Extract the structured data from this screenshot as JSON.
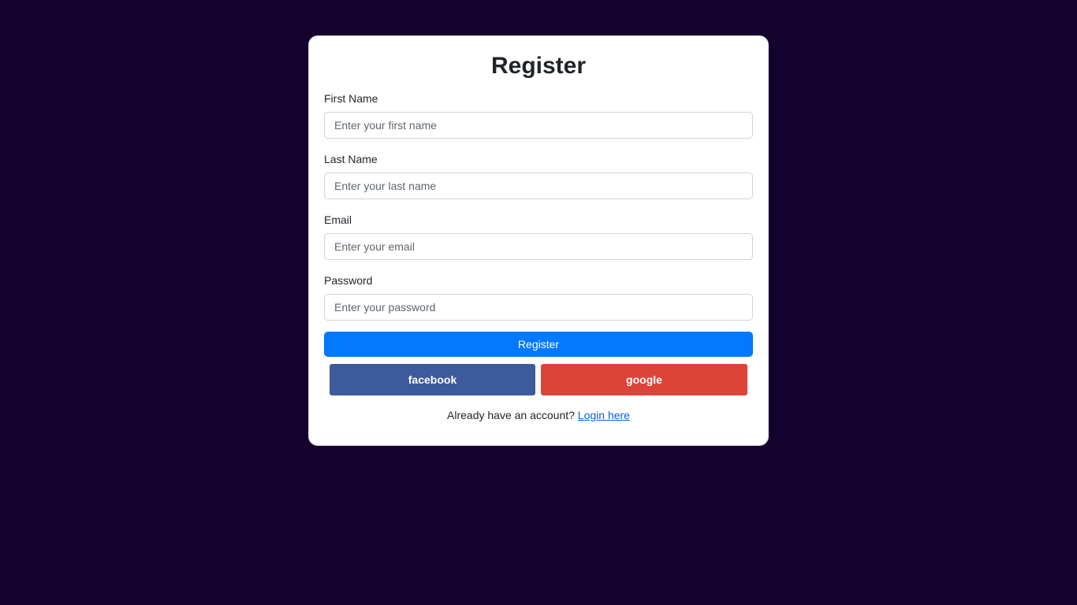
{
  "form": {
    "title": "Register",
    "fields": [
      {
        "label": "First Name",
        "placeholder": "Enter your first name",
        "value": ""
      },
      {
        "label": "Last Name",
        "placeholder": "Enter your last name",
        "value": ""
      },
      {
        "label": "Email",
        "placeholder": "Enter your email",
        "value": ""
      },
      {
        "label": "Password",
        "placeholder": "Enter your password",
        "value": ""
      }
    ],
    "submit_label": "Register"
  },
  "social": {
    "facebook_label": "facebook",
    "google_label": "google"
  },
  "footer": {
    "prompt_text": "Already have an account?",
    "login_link": "Login here"
  },
  "colors": {
    "background": "#14022e",
    "primary": "#0279fe",
    "facebook": "#3d5a9a",
    "google": "#dd4439"
  }
}
